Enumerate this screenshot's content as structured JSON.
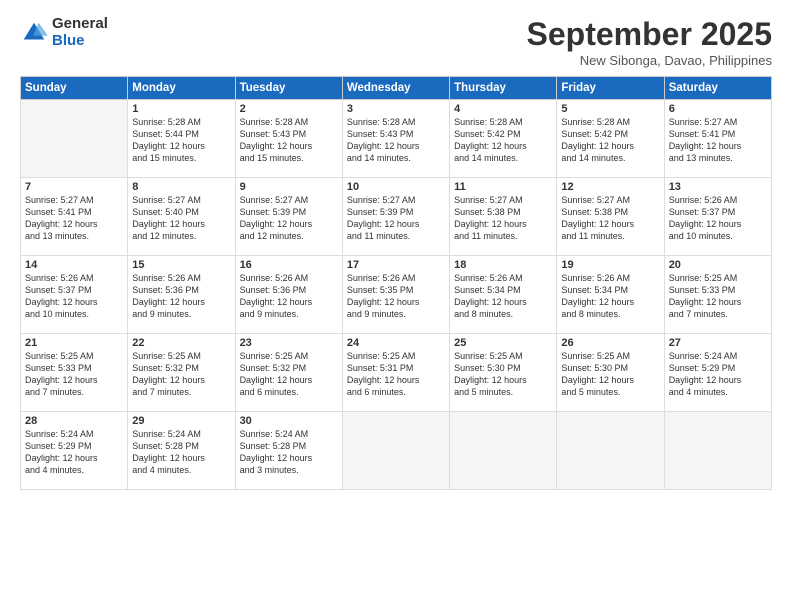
{
  "logo": {
    "general": "General",
    "blue": "Blue"
  },
  "header": {
    "month": "September 2025",
    "location": "New Sibonga, Davao, Philippines"
  },
  "weekdays": [
    "Sunday",
    "Monday",
    "Tuesday",
    "Wednesday",
    "Thursday",
    "Friday",
    "Saturday"
  ],
  "weeks": [
    [
      {
        "day": "",
        "sunrise": "",
        "sunset": "",
        "daylight": ""
      },
      {
        "day": "1",
        "sunrise": "Sunrise: 5:28 AM",
        "sunset": "Sunset: 5:44 PM",
        "daylight": "Daylight: 12 hours and 15 minutes."
      },
      {
        "day": "2",
        "sunrise": "Sunrise: 5:28 AM",
        "sunset": "Sunset: 5:43 PM",
        "daylight": "Daylight: 12 hours and 15 minutes."
      },
      {
        "day": "3",
        "sunrise": "Sunrise: 5:28 AM",
        "sunset": "Sunset: 5:43 PM",
        "daylight": "Daylight: 12 hours and 14 minutes."
      },
      {
        "day": "4",
        "sunrise": "Sunrise: 5:28 AM",
        "sunset": "Sunset: 5:42 PM",
        "daylight": "Daylight: 12 hours and 14 minutes."
      },
      {
        "day": "5",
        "sunrise": "Sunrise: 5:28 AM",
        "sunset": "Sunset: 5:42 PM",
        "daylight": "Daylight: 12 hours and 14 minutes."
      },
      {
        "day": "6",
        "sunrise": "Sunrise: 5:27 AM",
        "sunset": "Sunset: 5:41 PM",
        "daylight": "Daylight: 12 hours and 13 minutes."
      }
    ],
    [
      {
        "day": "7",
        "sunrise": "Sunrise: 5:27 AM",
        "sunset": "Sunset: 5:41 PM",
        "daylight": "Daylight: 12 hours and 13 minutes."
      },
      {
        "day": "8",
        "sunrise": "Sunrise: 5:27 AM",
        "sunset": "Sunset: 5:40 PM",
        "daylight": "Daylight: 12 hours and 12 minutes."
      },
      {
        "day": "9",
        "sunrise": "Sunrise: 5:27 AM",
        "sunset": "Sunset: 5:39 PM",
        "daylight": "Daylight: 12 hours and 12 minutes."
      },
      {
        "day": "10",
        "sunrise": "Sunrise: 5:27 AM",
        "sunset": "Sunset: 5:39 PM",
        "daylight": "Daylight: 12 hours and 11 minutes."
      },
      {
        "day": "11",
        "sunrise": "Sunrise: 5:27 AM",
        "sunset": "Sunset: 5:38 PM",
        "daylight": "Daylight: 12 hours and 11 minutes."
      },
      {
        "day": "12",
        "sunrise": "Sunrise: 5:27 AM",
        "sunset": "Sunset: 5:38 PM",
        "daylight": "Daylight: 12 hours and 11 minutes."
      },
      {
        "day": "13",
        "sunrise": "Sunrise: 5:26 AM",
        "sunset": "Sunset: 5:37 PM",
        "daylight": "Daylight: 12 hours and 10 minutes."
      }
    ],
    [
      {
        "day": "14",
        "sunrise": "Sunrise: 5:26 AM",
        "sunset": "Sunset: 5:37 PM",
        "daylight": "Daylight: 12 hours and 10 minutes."
      },
      {
        "day": "15",
        "sunrise": "Sunrise: 5:26 AM",
        "sunset": "Sunset: 5:36 PM",
        "daylight": "Daylight: 12 hours and 9 minutes."
      },
      {
        "day": "16",
        "sunrise": "Sunrise: 5:26 AM",
        "sunset": "Sunset: 5:36 PM",
        "daylight": "Daylight: 12 hours and 9 minutes."
      },
      {
        "day": "17",
        "sunrise": "Sunrise: 5:26 AM",
        "sunset": "Sunset: 5:35 PM",
        "daylight": "Daylight: 12 hours and 9 minutes."
      },
      {
        "day": "18",
        "sunrise": "Sunrise: 5:26 AM",
        "sunset": "Sunset: 5:34 PM",
        "daylight": "Daylight: 12 hours and 8 minutes."
      },
      {
        "day": "19",
        "sunrise": "Sunrise: 5:26 AM",
        "sunset": "Sunset: 5:34 PM",
        "daylight": "Daylight: 12 hours and 8 minutes."
      },
      {
        "day": "20",
        "sunrise": "Sunrise: 5:25 AM",
        "sunset": "Sunset: 5:33 PM",
        "daylight": "Daylight: 12 hours and 7 minutes."
      }
    ],
    [
      {
        "day": "21",
        "sunrise": "Sunrise: 5:25 AM",
        "sunset": "Sunset: 5:33 PM",
        "daylight": "Daylight: 12 hours and 7 minutes."
      },
      {
        "day": "22",
        "sunrise": "Sunrise: 5:25 AM",
        "sunset": "Sunset: 5:32 PM",
        "daylight": "Daylight: 12 hours and 7 minutes."
      },
      {
        "day": "23",
        "sunrise": "Sunrise: 5:25 AM",
        "sunset": "Sunset: 5:32 PM",
        "daylight": "Daylight: 12 hours and 6 minutes."
      },
      {
        "day": "24",
        "sunrise": "Sunrise: 5:25 AM",
        "sunset": "Sunset: 5:31 PM",
        "daylight": "Daylight: 12 hours and 6 minutes."
      },
      {
        "day": "25",
        "sunrise": "Sunrise: 5:25 AM",
        "sunset": "Sunset: 5:30 PM",
        "daylight": "Daylight: 12 hours and 5 minutes."
      },
      {
        "day": "26",
        "sunrise": "Sunrise: 5:25 AM",
        "sunset": "Sunset: 5:30 PM",
        "daylight": "Daylight: 12 hours and 5 minutes."
      },
      {
        "day": "27",
        "sunrise": "Sunrise: 5:24 AM",
        "sunset": "Sunset: 5:29 PM",
        "daylight": "Daylight: 12 hours and 4 minutes."
      }
    ],
    [
      {
        "day": "28",
        "sunrise": "Sunrise: 5:24 AM",
        "sunset": "Sunset: 5:29 PM",
        "daylight": "Daylight: 12 hours and 4 minutes."
      },
      {
        "day": "29",
        "sunrise": "Sunrise: 5:24 AM",
        "sunset": "Sunset: 5:28 PM",
        "daylight": "Daylight: 12 hours and 4 minutes."
      },
      {
        "day": "30",
        "sunrise": "Sunrise: 5:24 AM",
        "sunset": "Sunset: 5:28 PM",
        "daylight": "Daylight: 12 hours and 3 minutes."
      },
      {
        "day": "",
        "sunrise": "",
        "sunset": "",
        "daylight": ""
      },
      {
        "day": "",
        "sunrise": "",
        "sunset": "",
        "daylight": ""
      },
      {
        "day": "",
        "sunrise": "",
        "sunset": "",
        "daylight": ""
      },
      {
        "day": "",
        "sunrise": "",
        "sunset": "",
        "daylight": ""
      }
    ]
  ]
}
